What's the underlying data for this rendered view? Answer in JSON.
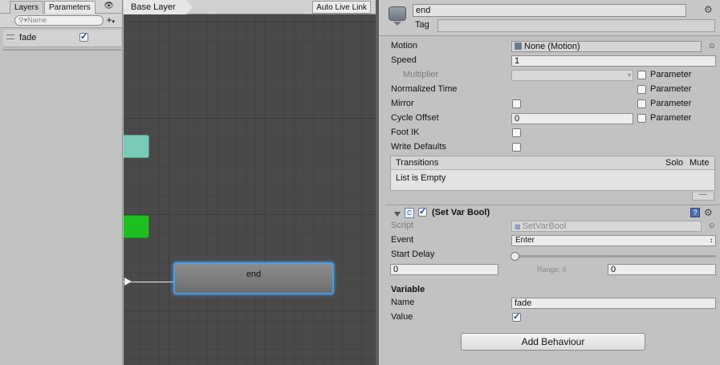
{
  "params_panel": {
    "tabs": [
      "Layers",
      "Parameters"
    ],
    "search_placeholder": "Name",
    "parameters": [
      {
        "name": "fade",
        "type": "bool",
        "value": true
      }
    ]
  },
  "graph": {
    "breadcrumb": "Base Layer",
    "auto_live_link": "Auto Live Link",
    "selected_state_label": "end",
    "colors": {
      "teal_state": "#79c9b7",
      "green_state": "#1fbf21",
      "selected_outline": "#4c9be8"
    }
  },
  "inspector": {
    "state_name": "end",
    "tag_label": "Tag",
    "tag_value": "",
    "motion_label": "Motion",
    "motion_value": "None (Motion)",
    "speed_label": "Speed",
    "speed_value": "1",
    "multiplier_label": "Multiplier",
    "parameter_label": "Parameter",
    "normalized_time_label": "Normalized Time",
    "mirror_label": "Mirror",
    "cycle_offset_label": "Cycle Offset",
    "cycle_offset_value": "0",
    "foot_ik_label": "Foot IK",
    "write_defaults_label": "Write Defaults",
    "transitions": {
      "title": "Transitions",
      "solo": "Solo",
      "mute": "Mute",
      "empty_text": "List is Empty",
      "remove_symbol": "—"
    },
    "behaviour": {
      "title": "(Set Var Bool)",
      "script_label": "Script",
      "script_value": "SetVarBool",
      "event_label": "Event",
      "event_value": "Enter",
      "start_delay_label": "Start Delay",
      "start_delay_min": "0",
      "range_text": "Range: 0",
      "start_delay_max": "0",
      "start_delay_fraction": 0,
      "variable_heading": "Variable",
      "name_label": "Name",
      "name_value": "fade",
      "value_label": "Value",
      "value_checked": true
    },
    "add_behaviour": "Add Behaviour"
  }
}
